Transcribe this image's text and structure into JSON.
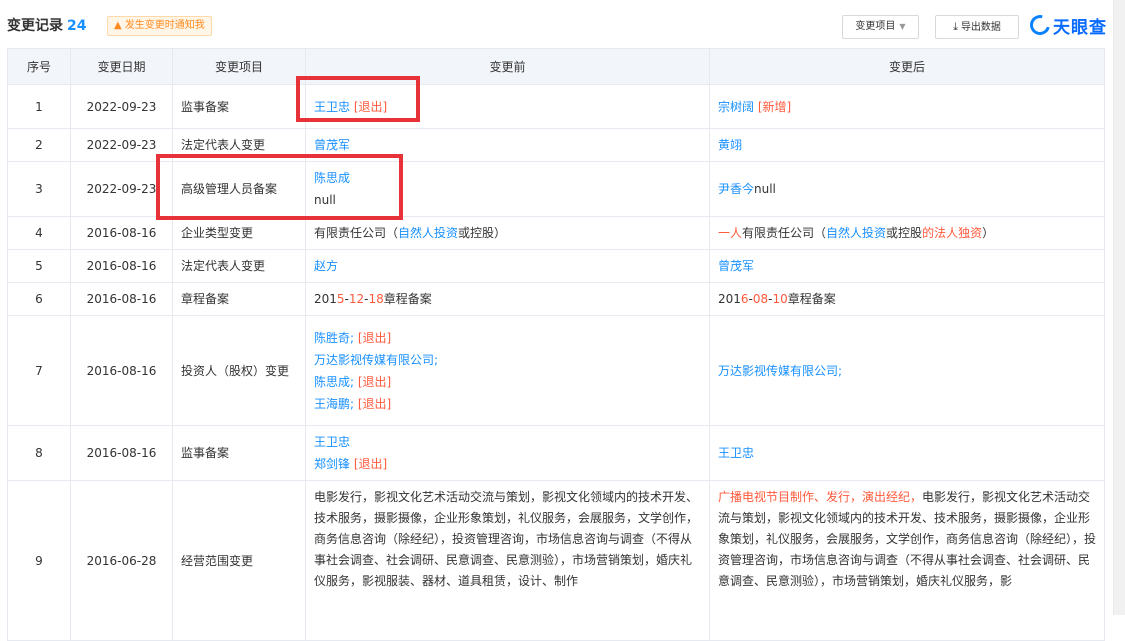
{
  "header": {
    "title": "变更记录",
    "count": "24",
    "notify_label": "发生变更时通知我",
    "select_label": "变更项目",
    "export_label": "导出数据",
    "logo_text": "天眼查"
  },
  "columns": [
    "序号",
    "变更日期",
    "变更项目",
    "变更前",
    "变更后"
  ],
  "rows": [
    {
      "num": "1",
      "date": "2022-09-23",
      "item": "监事备案",
      "before": [
        [
          {
            "t": "王卫忠",
            "c": "lnk"
          },
          {
            "t": " [退出]",
            "c": "red"
          }
        ]
      ],
      "after": [
        [
          {
            "t": "宗树阔",
            "c": "lnk"
          },
          {
            "t": " [新增]",
            "c": "red"
          }
        ]
      ]
    },
    {
      "num": "2",
      "date": "2022-09-23",
      "item": "法定代表人变更",
      "before": [
        [
          {
            "t": "曾茂军",
            "c": "lnk"
          }
        ]
      ],
      "after": [
        [
          {
            "t": "黄翊",
            "c": "lnk"
          }
        ]
      ]
    },
    {
      "num": "3",
      "date": "2022-09-23",
      "item": "高级管理人员备案",
      "before": [
        [
          {
            "t": "陈思成",
            "c": "lnk"
          }
        ],
        [
          {
            "t": "null",
            "c": ""
          }
        ]
      ],
      "after": [
        [
          {
            "t": "尹香今",
            "c": "lnk"
          },
          {
            "t": "null",
            "c": ""
          }
        ]
      ]
    },
    {
      "num": "4",
      "date": "2016-08-16",
      "item": "企业类型变更",
      "before": [
        [
          {
            "t": "有限责任公司（",
            "c": ""
          },
          {
            "t": "自然人投资",
            "c": "lnk"
          },
          {
            "t": "或控股）",
            "c": ""
          }
        ]
      ],
      "after": [
        [
          {
            "t": "一人",
            "c": "red"
          },
          {
            "t": "有限责任公司（",
            "c": ""
          },
          {
            "t": "自然人投资",
            "c": "lnk"
          },
          {
            "t": "或控股",
            "c": ""
          },
          {
            "t": "的法人独资",
            "c": "red"
          },
          {
            "t": "）",
            "c": ""
          }
        ]
      ]
    },
    {
      "num": "5",
      "date": "2016-08-16",
      "item": "法定代表人变更",
      "before": [
        [
          {
            "t": "赵方",
            "c": "lnk"
          }
        ]
      ],
      "after": [
        [
          {
            "t": "曾茂军",
            "c": "lnk"
          }
        ]
      ]
    },
    {
      "num": "6",
      "date": "2016-08-16",
      "item": "章程备案",
      "before": [
        [
          {
            "t": "201",
            "c": ""
          },
          {
            "t": "5",
            "c": "red"
          },
          {
            "t": "-",
            "c": ""
          },
          {
            "t": "12",
            "c": "red"
          },
          {
            "t": "-",
            "c": ""
          },
          {
            "t": "18",
            "c": "red"
          },
          {
            "t": "章程备案",
            "c": ""
          }
        ]
      ],
      "after": [
        [
          {
            "t": "201",
            "c": ""
          },
          {
            "t": "6",
            "c": "red"
          },
          {
            "t": "-",
            "c": ""
          },
          {
            "t": "08",
            "c": "red"
          },
          {
            "t": "-",
            "c": ""
          },
          {
            "t": "10",
            "c": "red"
          },
          {
            "t": "章程备案",
            "c": ""
          }
        ]
      ]
    },
    {
      "num": "7",
      "date": "2016-08-16",
      "item": "投资人（股权）变更",
      "before": [
        [
          {
            "t": "陈胜奇",
            "c": "lnk"
          },
          {
            "t": "; ",
            "c": "lnk"
          },
          {
            "t": "[退出]",
            "c": "red"
          }
        ],
        [
          {
            "t": "万达影视传媒有限公司;",
            "c": "lnk"
          }
        ],
        [
          {
            "t": "陈思成",
            "c": "lnk"
          },
          {
            "t": "; ",
            "c": "lnk"
          },
          {
            "t": "[退出]",
            "c": "red"
          }
        ],
        [
          {
            "t": "王海鹏",
            "c": "lnk"
          },
          {
            "t": "; ",
            "c": "lnk"
          },
          {
            "t": "[退出]",
            "c": "red"
          }
        ]
      ],
      "after": [
        [
          {
            "t": "万达影视传媒有限公司;",
            "c": "lnk"
          }
        ]
      ]
    },
    {
      "num": "8",
      "date": "2016-08-16",
      "item": "监事备案",
      "before": [
        [
          {
            "t": "王卫忠",
            "c": "lnk"
          }
        ],
        [
          {
            "t": "郑剑锋",
            "c": "lnk"
          },
          {
            "t": " [退出]",
            "c": "red"
          }
        ]
      ],
      "after": [
        [
          {
            "t": "王卫忠",
            "c": "lnk"
          }
        ]
      ]
    },
    {
      "num": "9",
      "date": "2016-06-28",
      "item": "经营范围变更",
      "before": [
        [
          {
            "t": "电影发行，影视文化艺术活动交流与策划，影视文化领域内的技术开发、技术服务，摄影摄像，企业形象策划，礼仪服务，会展服务，文学创作，商务信息咨询（除经纪），投资管理咨询，市场信息咨询与调查（不得从事社会调查、社会调研、民意调查、民意测验），市场营销策划，婚庆礼仪服务，影视服装、器材、道具租赁，设计、制作",
            "c": ""
          }
        ]
      ],
      "after": [
        [
          {
            "t": "广播电视节目制作、发行，演出经纪，",
            "c": "red"
          },
          {
            "t": "电影发行，影视文化艺术活动交流与策划，影视文化领域内的技术开发、技术服务，摄影摄像，企业形象策划，礼仪服务，会展服务，文学创作，商务信息咨询（除经纪），投资管理咨询，市场信息咨询与调查（不得从事社会调查、社会调研、民意调查、民意测验），市场营销策划，婚庆礼仪服务，影",
            "c": ""
          }
        ]
      ]
    }
  ]
}
